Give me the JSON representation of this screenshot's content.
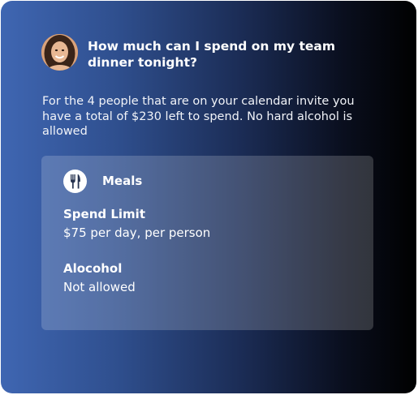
{
  "chat": {
    "question": "How much can I spend on my team dinner tonight?",
    "answer": "For the 4 people that are on your calendar invite you have a total of $230 left to spend. No hard alcohol is allowed"
  },
  "policy_card": {
    "icon": "fork-knife-icon",
    "title": "Meals",
    "fields": [
      {
        "label": "Spend Limit",
        "value": "$75 per day, per person"
      },
      {
        "label": "Alocohol",
        "value": "Not allowed"
      }
    ]
  },
  "colors": {
    "gradient_start": "#3f66b2",
    "gradient_end": "#000000",
    "text": "#ffffff"
  }
}
